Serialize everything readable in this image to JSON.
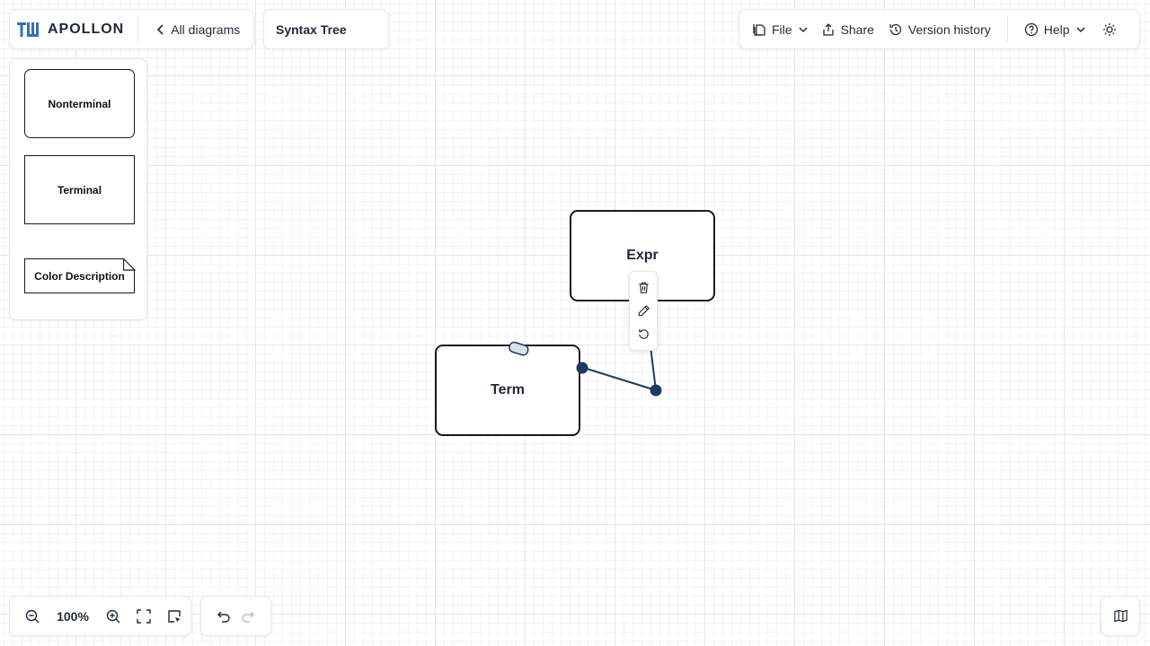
{
  "header": {
    "brand": "APOLLON",
    "back_label": "All diagrams",
    "diagram_title": "Syntax Tree"
  },
  "toolbar": {
    "file_label": "File",
    "share_label": "Share",
    "version_history_label": "Version history",
    "help_label": "Help"
  },
  "palette": {
    "items": [
      {
        "label": "Nonterminal"
      },
      {
        "label": "Terminal"
      },
      {
        "label": "Color Description"
      }
    ]
  },
  "canvas": {
    "nodes": [
      {
        "label": "Expr"
      },
      {
        "label": "Term"
      }
    ],
    "edge_toolbar": [
      "trash-icon",
      "pencil-icon",
      "reset-icon"
    ]
  },
  "zoom": {
    "level": "100%"
  },
  "colors": {
    "accent": "#1e3a5f",
    "logo_blue": "#3070b3",
    "grid": "#e4e7ec"
  }
}
